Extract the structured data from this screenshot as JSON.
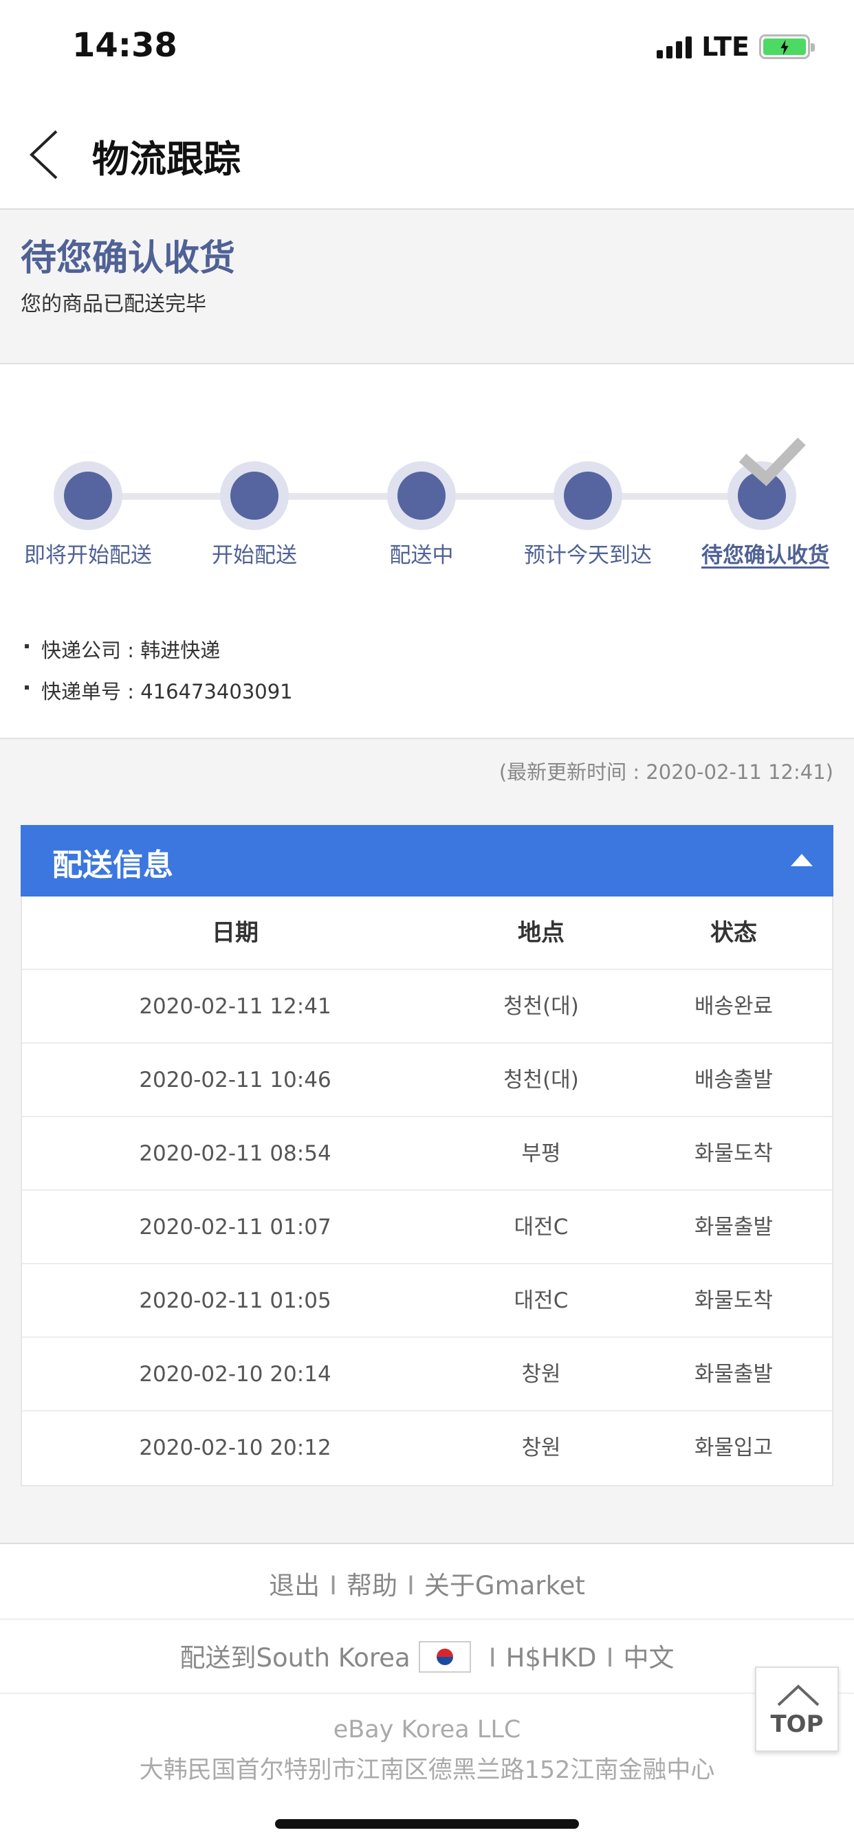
{
  "status_bar": {
    "time": "14:38",
    "network": "LTE"
  },
  "nav": {
    "title": "物流跟踪"
  },
  "order_status": {
    "title": "待您确认收货",
    "subtitle": "您的商品已配送完毕"
  },
  "progress": {
    "steps": [
      {
        "label": "即将开始配送"
      },
      {
        "label": "开始配送"
      },
      {
        "label": "配送中"
      },
      {
        "label": "预计今天到达"
      },
      {
        "label": "待您确认收货"
      }
    ]
  },
  "courier": {
    "company": "快递公司 : 韩进快递",
    "tracking": "快递单号 : 416473403091"
  },
  "update_time": "(最新更新时间 : 2020-02-11 12:41)",
  "delivery_info": {
    "title": "配送信息",
    "headers": [
      "日期",
      "地点",
      "状态"
    ],
    "rows": [
      [
        "2020-02-11 12:41",
        "청천(대)",
        "배송완료"
      ],
      [
        "2020-02-11 10:46",
        "청천(대)",
        "배송출발"
      ],
      [
        "2020-02-11 08:54",
        "부평",
        "화물도착"
      ],
      [
        "2020-02-11 01:07",
        "대전C",
        "화물출발"
      ],
      [
        "2020-02-11 01:05",
        "대전C",
        "화물도착"
      ],
      [
        "2020-02-10 20:14",
        "창원",
        "화물출발"
      ],
      [
        "2020-02-10 20:12",
        "창원",
        "화물입고"
      ]
    ]
  },
  "footer": {
    "logout": "退出",
    "help": "帮助",
    "about": "关于Gmarket",
    "ship_to": "配送到South Korea",
    "currency": "H$HKD",
    "language": "中文",
    "company": "eBay Korea LLC",
    "address": "大韩民国首尔特别市江南区德黑兰路152江南金融中心"
  },
  "top_button": {
    "label": "TOP"
  }
}
